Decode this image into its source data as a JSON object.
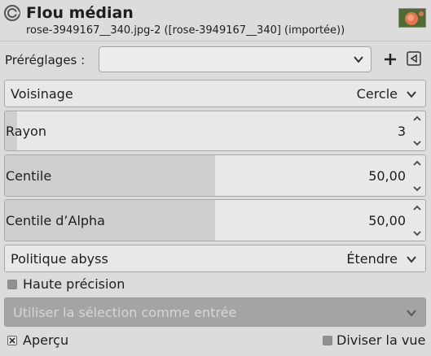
{
  "header": {
    "title": "Flou médian",
    "subtitle": "rose-3949167__340.jpg-2 ([rose-3949167__340] (importée))",
    "filter_icon": "gimp-wilber-icon",
    "thumbnail": "rose-thumbnail"
  },
  "presets": {
    "label": "Préréglages :",
    "value": "",
    "add_icon": "plus-icon",
    "menu_icon": "triangle-left-icon"
  },
  "neighborhood": {
    "label": "Voisinage",
    "value": "Cercle"
  },
  "radius": {
    "label": "Rayon",
    "value": "3",
    "fill_fraction": 0.03
  },
  "percentile": {
    "label": "Centile",
    "value": "50,00",
    "fill_fraction": 0.5
  },
  "alpha_percentile": {
    "label": "Centile d’Alpha",
    "value": "50,00",
    "fill_fraction": 0.5
  },
  "abyss_policy": {
    "label": "Politique abyss",
    "value": "Étendre"
  },
  "high_precision": {
    "label": "Haute précision",
    "checked": false
  },
  "selection_input": {
    "label": "Utiliser la sélection comme entrée",
    "disabled": true
  },
  "preview": {
    "label": "Aperçu",
    "checked": true
  },
  "split_view": {
    "label": "Diviser la vue",
    "checked": false
  }
}
